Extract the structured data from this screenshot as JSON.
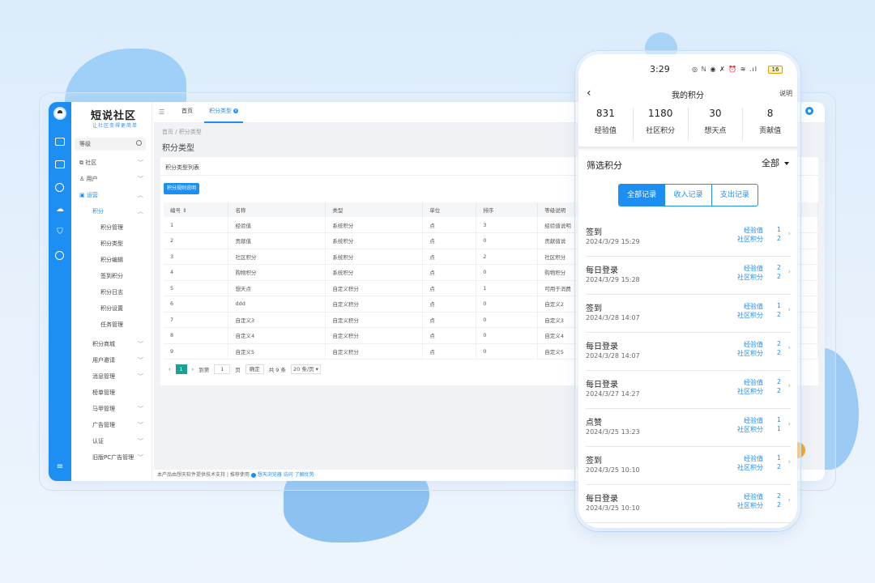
{
  "admin": {
    "logo": "短说社区",
    "logo_sub": "让社区变得更简单",
    "search_placeholder": "等级",
    "sidebar": [
      {
        "label": "社区",
        "chevron": "﹀"
      },
      {
        "label": "用户",
        "chevron": "﹀"
      },
      {
        "label": "运营",
        "chevron": "︿",
        "active": true
      },
      {
        "label": "积分",
        "chevron": "︿",
        "active": true
      },
      {
        "label": "积分管理"
      },
      {
        "label": "积分类型"
      },
      {
        "label": "积分编辑"
      },
      {
        "label": "签到积分"
      },
      {
        "label": "积分日志"
      },
      {
        "label": "积分设置"
      },
      {
        "label": "任务管理"
      },
      {
        "label": "积分商城",
        "chevron": "﹀"
      },
      {
        "label": "用户邀请",
        "chevron": "﹀"
      },
      {
        "label": "消息管理",
        "chevron": "﹀"
      },
      {
        "label": "榜单管理"
      },
      {
        "label": "马甲管理",
        "chevron": "﹀"
      },
      {
        "label": "广告管理",
        "chevron": "﹀"
      },
      {
        "label": "认证",
        "chevron": "﹀"
      },
      {
        "label": "旧版PC广告管理",
        "chevron": "﹀"
      }
    ],
    "tabs": {
      "home": "首页",
      "current": "积分类型"
    },
    "breadcrumb": "首页  /  积分类型",
    "page_title": "积分类型",
    "card_title": "积分类型列表",
    "rule_button": "积分规则说明",
    "columns": [
      "编号 ⇕",
      "名称",
      "类型",
      "单位",
      "排序",
      "等级说明"
    ],
    "rows": [
      [
        "1",
        "经验值",
        "系统积分",
        "点",
        "3",
        "经验值说明"
      ],
      [
        "2",
        "贡献值",
        "系统积分",
        "点",
        "0",
        "贡献值说"
      ],
      [
        "3",
        "社区积分",
        "系统积分",
        "点",
        "2",
        "社区积分"
      ],
      [
        "4",
        "购物积分",
        "系统积分",
        "点",
        "0",
        "购物积分"
      ],
      [
        "5",
        "想天点",
        "自定义积分",
        "点",
        "1",
        "可用于消费"
      ],
      [
        "6",
        "ddd",
        "自定义积分",
        "点",
        "0",
        "自定义2"
      ],
      [
        "7",
        "自定义3",
        "自定义积分",
        "点",
        "0",
        "自定义3"
      ],
      [
        "8",
        "自定义4",
        "自定义积分",
        "点",
        "0",
        "自定义4"
      ],
      [
        "9",
        "自定义5",
        "自定义积分",
        "点",
        "0",
        "自定义5"
      ]
    ],
    "pager": {
      "current": "1",
      "goto": "到第",
      "page_input": "1",
      "page_unit": "页",
      "confirm": "确定",
      "total": "共 9 条",
      "per_page": "20 条/页"
    },
    "footer": {
      "support": "本产品由想天软件提供技术支持",
      "sep": "|",
      "recommend": "推荐使用",
      "brand": "想天浏览器",
      "tail": "访问 了解优势"
    }
  },
  "phone": {
    "time": "3:29",
    "status_icons": "◎ ℕ ◉ ✗ ⏰ ≋ .ıl",
    "battery": "16",
    "title": "我的积分",
    "explain": "说明",
    "stats": [
      {
        "value": "831",
        "label": "经验值"
      },
      {
        "value": "1180",
        "label": "社区积分"
      },
      {
        "value": "30",
        "label": "想天点"
      },
      {
        "value": "8",
        "label": "贡献值"
      }
    ],
    "filter_label": "筛选积分",
    "filter_value": "全部",
    "segments": [
      "全部记录",
      "收入记录",
      "支出记录"
    ],
    "records": [
      {
        "name": "签到",
        "date": "2024/3/29 15:29",
        "k1": "经验值",
        "v1": "1",
        "k2": "社区积分",
        "v2": "2"
      },
      {
        "name": "每日登录",
        "date": "2024/3/29 15:28",
        "k1": "经验值",
        "v1": "2",
        "k2": "社区积分",
        "v2": "2"
      },
      {
        "name": "签到",
        "date": "2024/3/28 14:07",
        "k1": "经验值",
        "v1": "1",
        "k2": "社区积分",
        "v2": "2"
      },
      {
        "name": "每日登录",
        "date": "2024/3/28 14:07",
        "k1": "经验值",
        "v1": "2",
        "k2": "社区积分",
        "v2": "2"
      },
      {
        "name": "每日登录",
        "date": "2024/3/27 14:27",
        "k1": "经验值",
        "v1": "2",
        "k2": "社区积分",
        "v2": "2"
      },
      {
        "name": "点赞",
        "date": "2024/3/25 13:23",
        "k1": "经验值",
        "v1": "1",
        "k2": "社区积分",
        "v2": "1"
      },
      {
        "name": "签到",
        "date": "2024/3/25 10:10",
        "k1": "经验值",
        "v1": "1",
        "k2": "社区积分",
        "v2": "2"
      },
      {
        "name": "每日登录",
        "date": "2024/3/25 10:10",
        "k1": "经验值",
        "v1": "2",
        "k2": "社区积分",
        "v2": "2"
      }
    ]
  },
  "colors": {
    "accent": "#1e8ff2",
    "pager_active": "#1aa094"
  }
}
